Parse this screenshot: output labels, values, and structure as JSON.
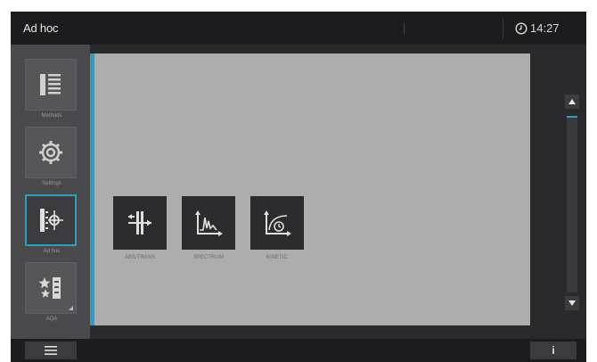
{
  "header": {
    "title": "Ad hoc",
    "time": "14:27"
  },
  "nav": [
    {
      "label": "Methods",
      "icon": "methods-list-icon"
    },
    {
      "label": "Settings",
      "icon": "settings-gear-icon"
    },
    {
      "label": "Ad hoc",
      "icon": "ad-hoc-icon",
      "active": true
    },
    {
      "label": "AQA",
      "icon": "aqa-stars-icon"
    }
  ],
  "tiles": [
    {
      "label": "ABS/TRANS",
      "icon": "abs-trans-icon"
    },
    {
      "label": "SPECTRUM",
      "icon": "spectrum-icon"
    },
    {
      "label": "KINETIC",
      "icon": "kinetic-icon"
    }
  ],
  "colors": {
    "accent": "#2a9fc6",
    "content_bg": "#adadad",
    "bar_bg": "#1c1c1e"
  },
  "footer": {
    "info_label": "i"
  }
}
